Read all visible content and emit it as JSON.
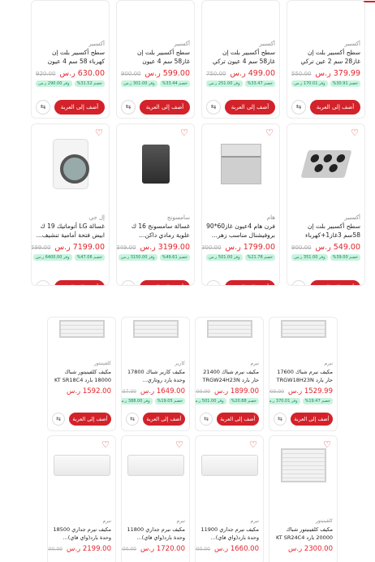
{
  "ui": {
    "add_label": "أضف إلى العربة",
    "compare_icon": "compare-arrows-icon",
    "heart_icon": "heart-icon",
    "accent": "#d3222a",
    "green_bg": "#c9f3df"
  },
  "section1": {
    "row1": [
      {
        "brand": "أكسبير",
        "title": "سطح أكسبير بلت إن غاز28 سم 2 عين تركي استيل...",
        "price": "379.99 ر.س",
        "old": "550.00",
        "b1": "خصم 30.91%",
        "b2": "وفر 170.01 ر.س"
      },
      {
        "brand": "أكسبير",
        "title": "سطح أكسبير بلت إن غاز58 سم 4 عيون تركي استيل...",
        "price": "499.00 ر.س",
        "old": "750.00",
        "b1": "خصم 33.47%",
        "b2": "وفر 251.00 ر.س"
      },
      {
        "brand": "أكسبير",
        "title": "سطح أكسبير بلت إن غاز58 سم 4 عيون زهرتركي استيـ...",
        "price": "599.00 ر.س",
        "old": "900.00",
        "b1": "خصم 33.44%",
        "b2": "وفر 301.00 ر.س"
      },
      {
        "brand": "أكسبير",
        "title": "سطح أكسبير بلت إن كهرباء 58 سم 4 عيون حجرتركي استـ...",
        "price": "630.00 ر.س",
        "old": "920.00",
        "b1": "خصم 31.52%",
        "b2": "وفر 290.00 ر.س"
      }
    ],
    "row2": [
      {
        "brand": "أكسبير",
        "title": "سطح أكسبير بلت إن 58سم 3غاز1+كهرباء تركي استيل...",
        "price": "549.00 ر.س",
        "old": "900.00",
        "b1": "خصم 39.00%",
        "b2": "وفر 351.00 ر.س",
        "img": "hob"
      },
      {
        "brand": "هام",
        "title": "فرن هام 4عيون غاز60*90 بروفيشنال مناسب زهر...",
        "price": "1799.00 ر.س",
        "old": "2300.00",
        "b1": "خصم 21.78%",
        "b2": "وفر 501.00 ر.س",
        "img": "cooker"
      },
      {
        "brand": "سامسونج",
        "title": "غسالة سامسونج 16 ك علوية رمادي داكن...",
        "price": "3199.00 ر.س",
        "old": "6349.00",
        "b1": "خصم 49.61%",
        "b2": "وفر 3150.00 ر.س",
        "img": "topload"
      },
      {
        "brand": "إل جي",
        "title": "غسالة LG أتوماتيك 19 ك ابيض فتحة أمامية تنشيف...",
        "price": "7199.00 ر.س",
        "old": "13599.00",
        "b1": "خصم 47.06%",
        "b2": "وفر 6400.00 ر.س",
        "img": "washer"
      }
    ]
  },
  "section2": {
    "row1": [
      {
        "brand": "نيرم",
        "title": "مكيف نيرم شباك 17600 حار بارد TRGW18H23N",
        "price": "1529.99 ر.س",
        "old": "1900.00",
        "b1": "خصم 19.47%",
        "b2": "وفر 370.01 ر.س"
      },
      {
        "brand": "نيرم",
        "title": "مكيف نيرم شباك 21400 حار بارد TRGW24H23N",
        "price": "1899.00 ر.س",
        "old": "2400.00",
        "b1": "خصم 20.88%",
        "b2": "وفر 501.00 ر.س"
      },
      {
        "brand": "كارير",
        "title": "مكيف كارير شباك 17800 وحدة بارد روتاري...",
        "price": "1649.00 ر.س",
        "old": "2037.00",
        "b1": "خصم 19.05%",
        "b2": "وفر 388.00 ر.س"
      },
      {
        "brand": "كلفينيتور",
        "title": "مكيف كلفينيتور شباك 18000 بارد KT SR18C4",
        "price": "1592.00 ر.س",
        "old": "",
        "b1": "",
        "b2": ""
      }
    ],
    "row2": [
      {
        "brand": "كلفينيتور",
        "title": "مكيف كلفينيتور شباك 20000 بارد KT SR24C4",
        "price": "2300.00 ر.س",
        "old": "",
        "img": "ac-win"
      },
      {
        "brand": "نيرم",
        "title": "مكيف نيرم جداري 11900 وحدة بارد(واي فاي)...",
        "price": "1660.00 ر.س",
        "old": "2000.00",
        "img": "ac"
      },
      {
        "brand": "نيرم",
        "title": "مكيف نيرم جداري 11800 وحدة بارد(واي فاي)...",
        "price": "1720.00 ر.س",
        "old": "2100.00",
        "img": "ac"
      },
      {
        "brand": "نيرم",
        "title": "مكيف نيرم جداري 18500 وحدة بارد(واي فاي)...",
        "price": "2199.00 ر.س",
        "old": "2700.00",
        "img": "ac"
      }
    ]
  }
}
